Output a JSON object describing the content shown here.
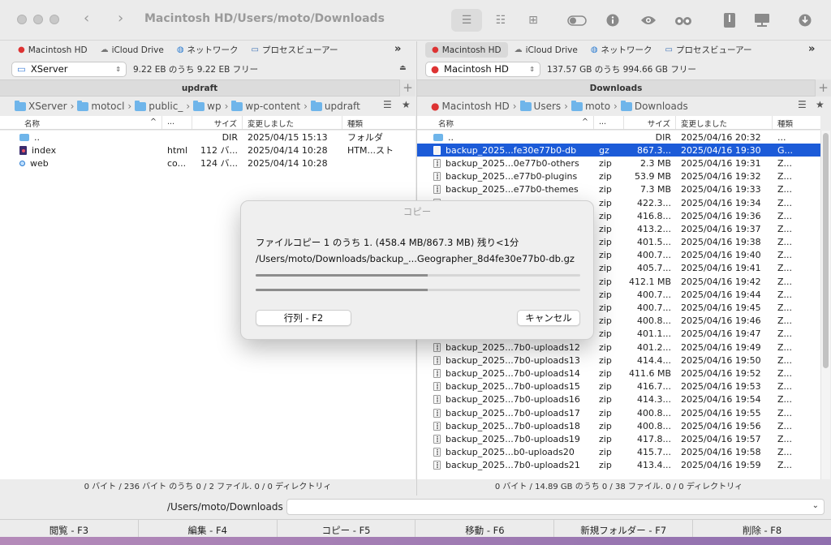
{
  "window": {
    "title": "Macintosh HD/Users/moto/Downloads"
  },
  "favorites": {
    "left": [
      {
        "label": "Macintosh HD",
        "icon": "apple-icon"
      },
      {
        "label": "iCloud Drive",
        "icon": "cloud-icon"
      },
      {
        "label": "ネットワーク",
        "icon": "globe-icon"
      },
      {
        "label": "プロセスビューアー",
        "icon": "monitor-icon"
      }
    ],
    "right": [
      {
        "label": "Macintosh HD",
        "icon": "apple-icon"
      },
      {
        "label": "iCloud Drive",
        "icon": "cloud-icon"
      },
      {
        "label": "ネットワーク",
        "icon": "globe-icon"
      },
      {
        "label": "プロセスビューアー",
        "icon": "monitor-icon"
      }
    ],
    "more": "»"
  },
  "left_panel": {
    "volume": "XServer",
    "free": "9.22 EB のうち 9.22 EB フリー",
    "tab": "updraft",
    "path": [
      "XServer",
      "motocl",
      "public_",
      "wp",
      "wp-content",
      "updraft"
    ],
    "columns": {
      "name": "名称",
      "ext": "...",
      "size": "サイズ",
      "modified": "変更しました",
      "kind": "種類"
    },
    "rows": [
      {
        "name": "..",
        "ext": "",
        "size": "DIR",
        "modified": "2025/04/15 15:13",
        "kind": "フォルダ",
        "type": "dir"
      },
      {
        "name": "index",
        "ext": "html",
        "size": "112 バ...",
        "modified": "2025/04/14 10:28",
        "kind": "HTM...スト",
        "type": "html"
      },
      {
        "name": "web",
        "ext": "co...",
        "size": "124 バ...",
        "modified": "2025/04/14 10:28",
        "kind": "",
        "type": "dot"
      }
    ],
    "status": "0 バイト / 236 バイト のうち 0 / 2 ファイル. 0 / 0 ディレクトリィ"
  },
  "right_panel": {
    "volume": "Macintosh HD",
    "free": "137.57 GB のうち 994.66 GB フリー",
    "tab": "Downloads",
    "path": [
      "Macintosh HD",
      "Users",
      "moto",
      "Downloads"
    ],
    "columns": {
      "name": "名称",
      "ext": "...",
      "size": "サイズ",
      "modified": "変更しました",
      "kind": "種類"
    },
    "rows": [
      {
        "name": "..",
        "ext": "",
        "size": "DIR",
        "modified": "2025/04/16 20:32",
        "kind": "...",
        "type": "dir"
      },
      {
        "name": "backup_2025...fe30e77b0-db",
        "ext": "gz",
        "size": "867.3...",
        "modified": "2025/04/16 19:30",
        "kind": "G...",
        "type": "gz",
        "selected": true
      },
      {
        "name": "backup_2025...0e77b0-others",
        "ext": "zip",
        "size": "2.3 MB",
        "modified": "2025/04/16 19:31",
        "kind": "Z...",
        "type": "zip"
      },
      {
        "name": "backup_2025...e77b0-plugins",
        "ext": "zip",
        "size": "53.9 MB",
        "modified": "2025/04/16 19:32",
        "kind": "Z...",
        "type": "zip"
      },
      {
        "name": "backup_2025...e77b0-themes",
        "ext": "zip",
        "size": "7.3 MB",
        "modified": "2025/04/16 19:33",
        "kind": "Z...",
        "type": "zip"
      },
      {
        "name": "",
        "ext": "zip",
        "size": "422.3...",
        "modified": "2025/04/16 19:34",
        "kind": "Z...",
        "type": "zip"
      },
      {
        "name": "",
        "ext": "zip",
        "size": "416.8...",
        "modified": "2025/04/16 19:36",
        "kind": "Z...",
        "type": "zip"
      },
      {
        "name": "",
        "ext": "zip",
        "size": "413.2...",
        "modified": "2025/04/16 19:37",
        "kind": "Z...",
        "type": "zip"
      },
      {
        "name": "",
        "ext": "zip",
        "size": "401.5...",
        "modified": "2025/04/16 19:38",
        "kind": "Z...",
        "type": "zip"
      },
      {
        "name": "",
        "ext": "zip",
        "size": "400.7...",
        "modified": "2025/04/16 19:40",
        "kind": "Z...",
        "type": "zip"
      },
      {
        "name": "",
        "ext": "zip",
        "size": "405.7...",
        "modified": "2025/04/16 19:41",
        "kind": "Z...",
        "type": "zip"
      },
      {
        "name": "",
        "ext": "zip",
        "size": "412.1 MB",
        "modified": "2025/04/16 19:42",
        "kind": "Z...",
        "type": "zip"
      },
      {
        "name": "",
        "ext": "zip",
        "size": "400.7...",
        "modified": "2025/04/16 19:44",
        "kind": "Z...",
        "type": "zip"
      },
      {
        "name": "",
        "ext": "zip",
        "size": "400.7...",
        "modified": "2025/04/16 19:45",
        "kind": "Z...",
        "type": "zip"
      },
      {
        "name": "",
        "ext": "zip",
        "size": "400.8...",
        "modified": "2025/04/16 19:46",
        "kind": "Z...",
        "type": "zip"
      },
      {
        "name": "",
        "ext": "zip",
        "size": "401.1...",
        "modified": "2025/04/16 19:47",
        "kind": "Z...",
        "type": "zip"
      },
      {
        "name": "backup_2025...7b0-uploads12",
        "ext": "zip",
        "size": "401.2...",
        "modified": "2025/04/16 19:49",
        "kind": "Z...",
        "type": "zip"
      },
      {
        "name": "backup_2025...7b0-uploads13",
        "ext": "zip",
        "size": "414.4...",
        "modified": "2025/04/16 19:50",
        "kind": "Z...",
        "type": "zip"
      },
      {
        "name": "backup_2025...7b0-uploads14",
        "ext": "zip",
        "size": "411.6 MB",
        "modified": "2025/04/16 19:52",
        "kind": "Z...",
        "type": "zip"
      },
      {
        "name": "backup_2025...7b0-uploads15",
        "ext": "zip",
        "size": "416.7...",
        "modified": "2025/04/16 19:53",
        "kind": "Z...",
        "type": "zip"
      },
      {
        "name": "backup_2025...7b0-uploads16",
        "ext": "zip",
        "size": "414.3...",
        "modified": "2025/04/16 19:54",
        "kind": "Z...",
        "type": "zip"
      },
      {
        "name": "backup_2025...7b0-uploads17",
        "ext": "zip",
        "size": "400.8...",
        "modified": "2025/04/16 19:55",
        "kind": "Z...",
        "type": "zip"
      },
      {
        "name": "backup_2025...7b0-uploads18",
        "ext": "zip",
        "size": "400.8...",
        "modified": "2025/04/16 19:56",
        "kind": "Z...",
        "type": "zip"
      },
      {
        "name": "backup_2025...7b0-uploads19",
        "ext": "zip",
        "size": "417.8...",
        "modified": "2025/04/16 19:57",
        "kind": "Z...",
        "type": "zip"
      },
      {
        "name": "backup_2025...b0-uploads20",
        "ext": "zip",
        "size": "415.7...",
        "modified": "2025/04/16 19:58",
        "kind": "Z...",
        "type": "zip"
      },
      {
        "name": "backup_2025...7b0-uploads21",
        "ext": "zip",
        "size": "413.4...",
        "modified": "2025/04/16 19:59",
        "kind": "Z...",
        "type": "zip"
      }
    ],
    "status": "0 バイト / 14.89 GB のうち 0 / 38 ファイル. 0 / 0 ディレクトリィ"
  },
  "command_line": {
    "path": "/Users/moto/Downloads",
    "value": ""
  },
  "function_keys": [
    "閲覧 - F3",
    "編集 - F4",
    "コピー - F5",
    "移動 - F6",
    "新規フォルダー - F7",
    "削除 - F8"
  ],
  "dialog": {
    "title": "コピー",
    "line1": "ファイルコピー 1 のうち 1. (458.4 MB/867.3 MB) 残り<1分",
    "line2": "/Users/moto/Downloads/backup_...Geographer_8d4fe30e77b0-db.gz",
    "progress_file": 0.53,
    "progress_total": 0.53,
    "queue_button": "行列 - F2",
    "cancel_button": "キャンセル"
  },
  "colors": {
    "selection": "#1c5bd8",
    "folder": "#6fb5ea"
  }
}
